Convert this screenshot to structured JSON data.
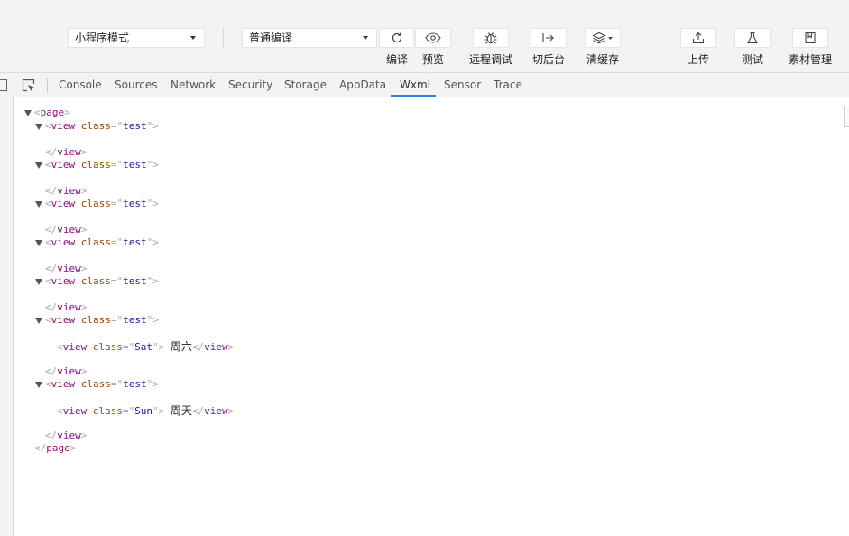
{
  "toolbar": {
    "mode_select": "小程序模式",
    "compile_select": "普通编译",
    "buttons": {
      "compile": "编译",
      "preview": "预览",
      "remote_debug": "远程调试",
      "background": "切后台",
      "clear_cache": "清缓存",
      "upload": "上传",
      "test": "测试",
      "assets": "素材管理"
    }
  },
  "devtools": {
    "tabs": [
      "Console",
      "Sources",
      "Network",
      "Security",
      "Storage",
      "AppData",
      "Wxml",
      "Sensor",
      "Trace"
    ],
    "active_tab": "Wxml"
  },
  "wxml": {
    "root_open": "page",
    "root_close": "page",
    "tag": "view",
    "attr": "class",
    "test_value": "test",
    "close_view": "view",
    "sat": {
      "value": "Sat",
      "text": "周六"
    },
    "sun": {
      "value": "Sun",
      "text": "周天"
    }
  }
}
